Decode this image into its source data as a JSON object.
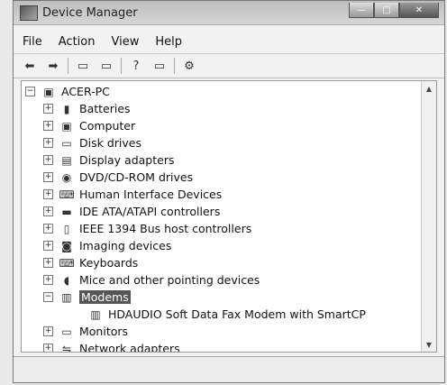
{
  "window": {
    "title": "Device Manager",
    "controls": {
      "minimize": "—",
      "maximize": "□",
      "close": "✕"
    }
  },
  "menu": {
    "file": "File",
    "action": "Action",
    "view": "View",
    "help": "Help"
  },
  "toolbar": {
    "back": "⬅",
    "forward": "➡",
    "properties": "▭",
    "help": "?",
    "scan": "⚙"
  },
  "tree": {
    "root": "ACER-PC",
    "items": [
      {
        "label": "Batteries",
        "icon": "battery-icon",
        "glyph": "▮"
      },
      {
        "label": "Computer",
        "icon": "computer-icon",
        "glyph": "▣"
      },
      {
        "label": "Disk drives",
        "icon": "disk-drive-icon",
        "glyph": "▭"
      },
      {
        "label": "Display adapters",
        "icon": "display-adapter-icon",
        "glyph": "▤"
      },
      {
        "label": "DVD/CD-ROM drives",
        "icon": "dvd-drive-icon",
        "glyph": "◉"
      },
      {
        "label": "Human Interface Devices",
        "icon": "hid-icon",
        "glyph": "⌨"
      },
      {
        "label": "IDE ATA/ATAPI controllers",
        "icon": "ide-controller-icon",
        "glyph": "▬"
      },
      {
        "label": "IEEE 1394 Bus host controllers",
        "icon": "ieee1394-icon",
        "glyph": "▯"
      },
      {
        "label": "Imaging devices",
        "icon": "camera-icon",
        "glyph": "◙"
      },
      {
        "label": "Keyboards",
        "icon": "keyboard-icon",
        "glyph": "⌨"
      },
      {
        "label": "Mice and other pointing devices",
        "icon": "mouse-icon",
        "glyph": "◖"
      },
      {
        "label": "Modems",
        "icon": "modem-icon",
        "glyph": "▥"
      },
      {
        "label": "HDAUDIO Soft Data Fax Modem with SmartCP",
        "icon": "modem-device-icon",
        "glyph": "▥"
      },
      {
        "label": "Monitors",
        "icon": "monitor-icon",
        "glyph": "▭"
      },
      {
        "label": "Network adapters",
        "icon": "network-adapter-icon",
        "glyph": "⇋"
      }
    ]
  },
  "status": ""
}
